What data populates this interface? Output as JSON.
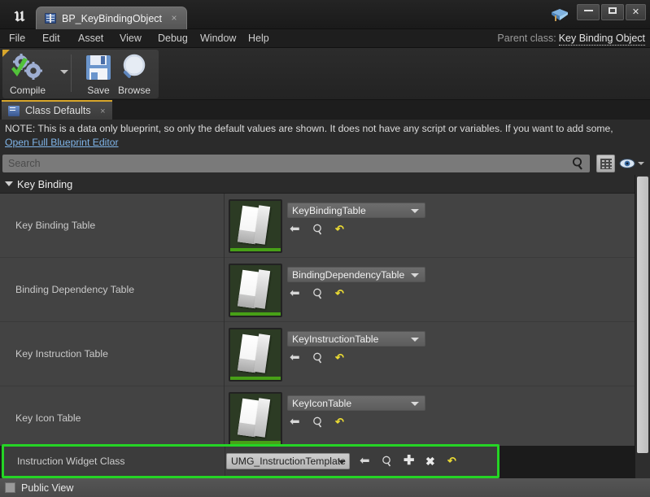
{
  "window": {
    "document_tab": {
      "label": "BP_KeyBindingObject",
      "icon": "blueprint-book-icon",
      "close": "×"
    },
    "app_logo": "𝔲",
    "editor_gem_icon": "unreal-gem-icon",
    "controls": {
      "minimize": "minimize-icon",
      "maximize": "maximize-icon",
      "close": "✕"
    }
  },
  "menu": {
    "items": [
      "File",
      "Edit",
      "Asset",
      "View",
      "Debug",
      "Window",
      "Help"
    ],
    "parent_class_label": "Parent class:",
    "parent_class_value": "Key Binding Object"
  },
  "toolbar": {
    "buttons": [
      {
        "label": "Compile",
        "icon": "compile-gears-check-icon"
      },
      {
        "label": "Save",
        "icon": "floppy-disk-icon"
      },
      {
        "label": "Browse",
        "icon": "magnifier-browse-icon"
      }
    ]
  },
  "panel_tab": {
    "label": "Class Defaults",
    "icon": "class-defaults-icon",
    "close": "×"
  },
  "note": {
    "text": "NOTE: This is a data only blueprint, so only the default values are shown.  It does not have any script or variables.  If you want to add some,",
    "link": "Open Full Blueprint Editor"
  },
  "search": {
    "placeholder": "Search",
    "value": "",
    "magnifier_icon": "search-icon",
    "grid_view_icon": "grid-view-icon",
    "visibility_icon": "eye-icon"
  },
  "category": {
    "title": "Key Binding",
    "expanded": true
  },
  "properties": [
    {
      "label": "Key Binding Table",
      "value": "KeyBindingTable",
      "thumbnail": "data-table-asset-thumbnail",
      "actions": [
        "use-selected-asset-icon",
        "browse-to-asset-icon",
        "reset-to-default-icon"
      ]
    },
    {
      "label": "Binding Dependency Table",
      "value": "BindingDependencyTable",
      "thumbnail": "data-table-asset-thumbnail",
      "actions": [
        "use-selected-asset-icon",
        "browse-to-asset-icon",
        "reset-to-default-icon"
      ]
    },
    {
      "label": "Key Instruction Table",
      "value": "KeyInstructionTable",
      "thumbnail": "data-table-asset-thumbnail",
      "actions": [
        "use-selected-asset-icon",
        "browse-to-asset-icon",
        "reset-to-default-icon"
      ]
    },
    {
      "label": "Key Icon Table",
      "value": "KeyIconTable",
      "thumbnail": "data-table-asset-thumbnail",
      "actions": [
        "use-selected-asset-icon",
        "browse-to-asset-icon",
        "reset-to-default-icon"
      ]
    }
  ],
  "highlighted_property": {
    "label": "Instruction Widget Class",
    "value": "UMG_InstructionTemplate",
    "highlight_color": "#25d425",
    "actions": [
      "use-selected-asset-icon",
      "browse-to-asset-icon",
      "add-icon",
      "clear-icon",
      "reset-to-default-icon"
    ]
  },
  "status_bar": {
    "label": "Public View",
    "icon": "checkbox-icon"
  },
  "colors": {
    "accent_green": "#25d425",
    "asset_green": "#47a017",
    "link_blue": "#7fb4e8",
    "tab_accent": "#d8a62b",
    "row_bg": "#434343",
    "panel_bg": "#2b2b2b"
  }
}
